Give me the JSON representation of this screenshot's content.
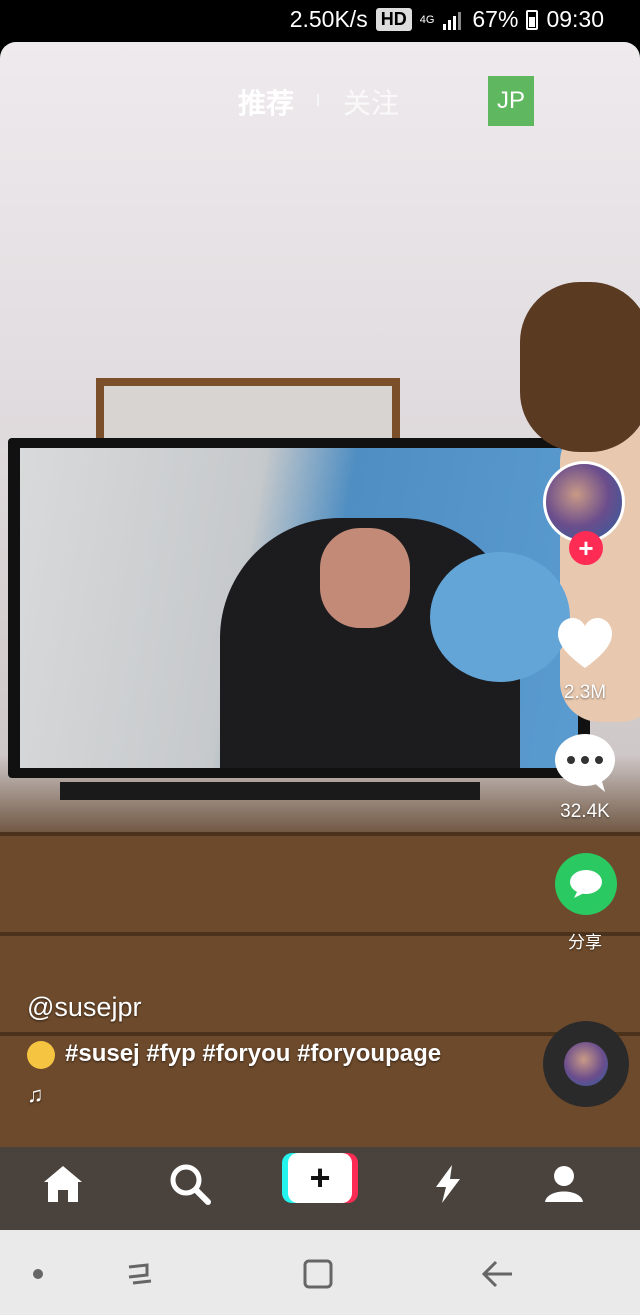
{
  "status_bar": {
    "speed": "2.50K/s",
    "hd_badge": "HD",
    "network": "4G",
    "battery": "67%",
    "time": "09:30"
  },
  "top_nav": {
    "tab_recommend": "推荐",
    "tab_following": "关注",
    "profile_badge": "JP"
  },
  "actions": {
    "likes": "2.3M",
    "comments": "32.4K",
    "share_label": "分享"
  },
  "caption": {
    "username": "@susejpr",
    "hashtags": "#susej #fyp #foryou #foryoupage"
  },
  "bottom_nav": {
    "items": [
      "home-icon",
      "search-icon",
      "create-button",
      "flash-icon",
      "profile-icon"
    ],
    "create_symbol": "+"
  },
  "colors": {
    "share_green": "#2bc962",
    "follow_red": "#fe2c55",
    "create_cyan": "#25f4ee",
    "badge_green": "#5fb85f"
  }
}
